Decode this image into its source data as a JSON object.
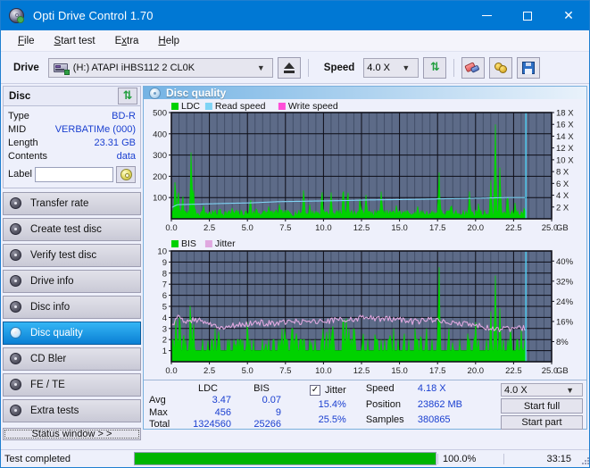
{
  "window": {
    "title": "Opti Drive Control 1.70",
    "minimize_label": "—",
    "maximize_label": "□",
    "close_label": "✕"
  },
  "menu": {
    "items": [
      {
        "label": "File"
      },
      {
        "label": "Start test"
      },
      {
        "label": "Extra"
      },
      {
        "label": "Help"
      }
    ]
  },
  "toolbar": {
    "drive_label": "Drive",
    "drive_value": "(H:)  ATAPI iHBS112  2 CL0K",
    "eject_title": "Eject",
    "speed_label": "Speed",
    "speed_value": "4.0 X",
    "refresh_title": "Refresh",
    "erase_title": "Erase",
    "gold_title": "Bookmarks",
    "save_title": "Save"
  },
  "sidebar": {
    "disc_panel": {
      "title": "Disc",
      "refresh_title": "Refresh disc",
      "rows": [
        {
          "key": "Type",
          "value": "BD-R"
        },
        {
          "key": "MID",
          "value": "VERBATIMe (000)"
        },
        {
          "key": "Length",
          "value": "23.31 GB"
        },
        {
          "key": "Contents",
          "value": "data"
        }
      ],
      "label_key": "Label",
      "label_value": "",
      "label_placeholder": "",
      "label_button_title": "Set label"
    },
    "nav": [
      {
        "label": "Transfer rate",
        "active": false
      },
      {
        "label": "Create test disc",
        "active": false
      },
      {
        "label": "Verify test disc",
        "active": false
      },
      {
        "label": "Drive info",
        "active": false
      },
      {
        "label": "Disc info",
        "active": false
      },
      {
        "label": "Disc quality",
        "active": true
      },
      {
        "label": "CD Bler",
        "active": false
      },
      {
        "label": "FE / TE",
        "active": false
      },
      {
        "label": "Extra tests",
        "active": false
      }
    ],
    "status_window_button": "Status window > >"
  },
  "content": {
    "header_title": "Disc quality"
  },
  "stats": {
    "col_headers": {
      "ldc": "LDC",
      "bis": "BIS"
    },
    "rows": [
      {
        "label": "Avg",
        "ldc": "3.47",
        "bis": "0.07"
      },
      {
        "label": "Max",
        "ldc": "456",
        "bis": "9"
      },
      {
        "label": "Total",
        "ldc": "1324560",
        "bis": "25266"
      }
    ],
    "jitter": {
      "label": "Jitter",
      "checked": true,
      "check_glyph": "✓",
      "avg": "15.4%",
      "max": "25.5%"
    },
    "speed": {
      "speed_label": "Speed",
      "speed_value": "4.18 X",
      "position_label": "Position",
      "position_value": "23862 MB",
      "samples_label": "Samples",
      "samples_value": "380865"
    },
    "actions": {
      "speed_select": "4.0 X",
      "start_full": "Start full",
      "start_part": "Start part"
    }
  },
  "statusbar": {
    "text": "Test completed",
    "percent": "100.0%",
    "progress": 100,
    "time": "33:15"
  },
  "colors": {
    "accent": "#0078d4",
    "ldc_green": "#00d200",
    "bis_green": "#00d200",
    "read_speed": "#7fd4f5",
    "write_speed": "#ff4fd8",
    "jitter_pink": "#e0a8e0",
    "plot_bg": "#5d6b88",
    "value_blue": "#1a3fd0",
    "progress_green": "#00b400"
  },
  "chart_data": [
    {
      "type": "area",
      "name": "disc-quality-ldc",
      "title": "",
      "xlabel": "GB",
      "ylabel": "",
      "x": [
        0,
        25
      ],
      "xlim": [
        0,
        25
      ],
      "xticks": [
        "0.0",
        "2.5",
        "5.0",
        "7.5",
        "10.0",
        "12.5",
        "15.0",
        "17.5",
        "20.0",
        "22.5",
        "25.0"
      ],
      "xtick_values": [
        0,
        2.5,
        5,
        7.5,
        10,
        12.5,
        15,
        17.5,
        20,
        22.5,
        25
      ],
      "x_unit": "GB",
      "ylim": [
        0,
        500
      ],
      "yticks": [
        100,
        200,
        300,
        400,
        500
      ],
      "ytick_labels": [
        "100",
        "200",
        "300",
        "400",
        "500"
      ],
      "y2lim": [
        0,
        18
      ],
      "y2ticks": [
        2,
        4,
        6,
        8,
        10,
        12,
        14,
        16,
        18
      ],
      "y2tick_labels": [
        "2 X",
        "4 X",
        "6 X",
        "8 X",
        "10 X",
        "12 X",
        "14 X",
        "16 X",
        "18 X"
      ],
      "grid": true,
      "legend_position": "top-left",
      "series": [
        {
          "name": "LDC",
          "color": "#00d200",
          "kind": "spikes",
          "note": "error-count spikes, baseline ~20-40, max 456 near 1.3GB and 21.3GB",
          "baseline": 25,
          "peaks": [
            {
              "x": 0.25,
              "y": 200
            },
            {
              "x": 0.45,
              "y": 150
            },
            {
              "x": 0.75,
              "y": 120
            },
            {
              "x": 1.3,
              "y": 340
            },
            {
              "x": 1.45,
              "y": 160
            },
            {
              "x": 2.1,
              "y": 70
            },
            {
              "x": 3.2,
              "y": 60
            },
            {
              "x": 4.0,
              "y": 55
            },
            {
              "x": 5.2,
              "y": 110
            },
            {
              "x": 5.6,
              "y": 60
            },
            {
              "x": 6.4,
              "y": 60
            },
            {
              "x": 7.1,
              "y": 70
            },
            {
              "x": 8.7,
              "y": 155
            },
            {
              "x": 9.1,
              "y": 70
            },
            {
              "x": 9.9,
              "y": 150
            },
            {
              "x": 10.5,
              "y": 130
            },
            {
              "x": 11.3,
              "y": 170
            },
            {
              "x": 11.6,
              "y": 150
            },
            {
              "x": 12.4,
              "y": 110
            },
            {
              "x": 12.8,
              "y": 120
            },
            {
              "x": 13.8,
              "y": 140
            },
            {
              "x": 14.8,
              "y": 70
            },
            {
              "x": 16.2,
              "y": 60
            },
            {
              "x": 17.6,
              "y": 230
            },
            {
              "x": 18.4,
              "y": 80
            },
            {
              "x": 19.6,
              "y": 130
            },
            {
              "x": 20.2,
              "y": 80
            },
            {
              "x": 21.0,
              "y": 200
            },
            {
              "x": 21.3,
              "y": 456
            },
            {
              "x": 21.6,
              "y": 250
            },
            {
              "x": 22.1,
              "y": 130
            },
            {
              "x": 22.6,
              "y": 80
            },
            {
              "x": 23.2,
              "y": 60
            }
          ]
        },
        {
          "name": "Read speed",
          "color": "#7fd4f5",
          "kind": "step-line",
          "axis": "right",
          "note": "read speed ramps gradually ~2.0X to ~3.6X across disc",
          "points": [
            {
              "x": 0.0,
              "y": 1.9
            },
            {
              "x": 0.4,
              "y": 2.4
            },
            {
              "x": 2.0,
              "y": 2.5
            },
            {
              "x": 3.4,
              "y": 2.6
            },
            {
              "x": 5.2,
              "y": 2.7
            },
            {
              "x": 7.0,
              "y": 2.9
            },
            {
              "x": 9.2,
              "y": 3.0
            },
            {
              "x": 11.5,
              "y": 3.1
            },
            {
              "x": 13.0,
              "y": 3.2
            },
            {
              "x": 16.2,
              "y": 3.3
            },
            {
              "x": 18.0,
              "y": 3.4
            },
            {
              "x": 20.4,
              "y": 3.5
            },
            {
              "x": 22.0,
              "y": 3.6
            },
            {
              "x": 23.3,
              "y": 3.6
            }
          ]
        },
        {
          "name": "Write speed",
          "color": "#ff4fd8",
          "kind": "line",
          "axis": "right",
          "note": "not plotted in this run",
          "points": []
        }
      ],
      "markers": [
        {
          "name": "end-of-data",
          "x": 23.31,
          "color": "#4fd0f5",
          "kind": "vline"
        }
      ]
    },
    {
      "type": "area",
      "name": "disc-quality-bis-jitter",
      "title": "",
      "xlabel": "GB",
      "ylabel": "",
      "xlim": [
        0,
        25
      ],
      "xticks": [
        "0.0",
        "2.5",
        "5.0",
        "7.5",
        "10.0",
        "12.5",
        "15.0",
        "17.5",
        "20.0",
        "22.5",
        "25.0"
      ],
      "xtick_values": [
        0,
        2.5,
        5,
        7.5,
        10,
        12.5,
        15,
        17.5,
        20,
        22.5,
        25
      ],
      "x_unit": "GB",
      "ylim": [
        0,
        10
      ],
      "yticks": [
        1,
        2,
        3,
        4,
        5,
        6,
        7,
        8,
        9,
        10
      ],
      "ytick_labels": [
        "1",
        "2",
        "3",
        "4",
        "5",
        "6",
        "7",
        "8",
        "9",
        "10"
      ],
      "y2lim": [
        0,
        44
      ],
      "y2ticks": [
        8,
        16,
        24,
        32,
        40
      ],
      "y2tick_labels": [
        "8%",
        "16%",
        "24%",
        "32%",
        "40%"
      ],
      "grid": true,
      "legend_position": "top-left",
      "series": [
        {
          "name": "BIS",
          "color": "#00d200",
          "kind": "spikes",
          "note": "mostly 1, frequent 2, occasional 4-6, max 9",
          "baseline": 1,
          "peaks": [
            {
              "x": 0.3,
              "y": 4
            },
            {
              "x": 0.55,
              "y": 5
            },
            {
              "x": 0.8,
              "y": 3
            },
            {
              "x": 1.25,
              "y": 6
            },
            {
              "x": 1.45,
              "y": 4
            },
            {
              "x": 2.4,
              "y": 2
            },
            {
              "x": 3.1,
              "y": 3
            },
            {
              "x": 4.2,
              "y": 2
            },
            {
              "x": 5.0,
              "y": 4
            },
            {
              "x": 6.2,
              "y": 2
            },
            {
              "x": 7.4,
              "y": 2
            },
            {
              "x": 8.2,
              "y": 3
            },
            {
              "x": 9.2,
              "y": 2
            },
            {
              "x": 10.2,
              "y": 3
            },
            {
              "x": 10.6,
              "y": 4
            },
            {
              "x": 11.3,
              "y": 5
            },
            {
              "x": 11.5,
              "y": 4
            },
            {
              "x": 12.0,
              "y": 4
            },
            {
              "x": 12.6,
              "y": 3
            },
            {
              "x": 13.4,
              "y": 3
            },
            {
              "x": 14.4,
              "y": 3
            },
            {
              "x": 15.3,
              "y": 3
            },
            {
              "x": 16.4,
              "y": 3
            },
            {
              "x": 17.6,
              "y": 9
            },
            {
              "x": 18.5,
              "y": 2
            },
            {
              "x": 19.5,
              "y": 3
            },
            {
              "x": 20.0,
              "y": 4
            },
            {
              "x": 21.0,
              "y": 5
            },
            {
              "x": 21.3,
              "y": 8
            },
            {
              "x": 21.6,
              "y": 5
            },
            {
              "x": 22.3,
              "y": 3
            },
            {
              "x": 23.0,
              "y": 3
            }
          ]
        },
        {
          "name": "Jitter",
          "color": "#e0a8e0",
          "kind": "line",
          "axis": "right",
          "note": "jitter % noisy trace, avg 15.4%, max 25.5%, drops near end",
          "points": [
            {
              "x": 0.1,
              "y": 14.5
            },
            {
              "x": 0.5,
              "y": 18.0
            },
            {
              "x": 1.0,
              "y": 15.5
            },
            {
              "x": 1.4,
              "y": 17.0
            },
            {
              "x": 2.0,
              "y": 16.0
            },
            {
              "x": 2.6,
              "y": 15.0
            },
            {
              "x": 3.2,
              "y": 14.0
            },
            {
              "x": 4.0,
              "y": 14.2
            },
            {
              "x": 5.0,
              "y": 15.0
            },
            {
              "x": 6.0,
              "y": 15.5
            },
            {
              "x": 7.0,
              "y": 15.2
            },
            {
              "x": 8.0,
              "y": 15.8
            },
            {
              "x": 9.0,
              "y": 15.6
            },
            {
              "x": 10.0,
              "y": 16.0
            },
            {
              "x": 11.0,
              "y": 16.5
            },
            {
              "x": 12.0,
              "y": 17.2
            },
            {
              "x": 13.0,
              "y": 17.5
            },
            {
              "x": 14.0,
              "y": 17.0
            },
            {
              "x": 15.0,
              "y": 16.4
            },
            {
              "x": 16.0,
              "y": 16.0
            },
            {
              "x": 17.0,
              "y": 16.5
            },
            {
              "x": 18.0,
              "y": 15.5
            },
            {
              "x": 19.0,
              "y": 15.0
            },
            {
              "x": 20.0,
              "y": 14.2
            },
            {
              "x": 21.0,
              "y": 13.5
            },
            {
              "x": 21.6,
              "y": 12.5
            },
            {
              "x": 22.2,
              "y": 13.0
            },
            {
              "x": 23.0,
              "y": 13.0
            },
            {
              "x": 23.3,
              "y": 13.2
            }
          ]
        }
      ],
      "markers": [
        {
          "name": "end-of-data",
          "x": 23.31,
          "color": "#4fd0f5",
          "kind": "vline"
        }
      ]
    }
  ]
}
